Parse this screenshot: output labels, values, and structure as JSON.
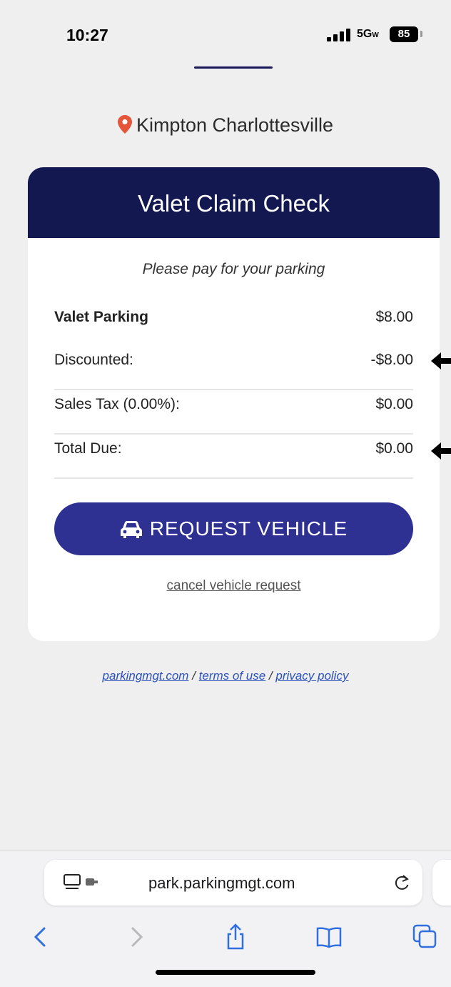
{
  "status_bar": {
    "time": "10:27",
    "network": "5G",
    "battery": "85"
  },
  "location": {
    "name": "Kimpton Charlottesville",
    "icon": "map-pin-icon",
    "icon_color": "#e4553a"
  },
  "card": {
    "title": "Valet Claim Check",
    "subtitle": "Please pay for your parking",
    "lines": [
      {
        "label": "Valet Parking",
        "value": "$8.00"
      },
      {
        "label": "Discounted:",
        "value": "-$8.00"
      },
      {
        "label": "Sales Tax (0.00%):",
        "value": "$0.00"
      },
      {
        "label": "Total Due:",
        "value": "$0.00"
      }
    ],
    "request_button": {
      "label": "REQUEST VEHICLE",
      "icon": "car-icon"
    },
    "cancel_link": "cancel vehicle request"
  },
  "footer": {
    "link_site": "parkingmgt.com",
    "link_terms": "terms of use",
    "link_privacy": "privacy policy",
    "separator": "/"
  },
  "browser": {
    "url": "park.parkingmgt.com",
    "toolbar": [
      "back-icon",
      "forward-icon",
      "share-icon",
      "bookmarks-icon",
      "tabs-icon"
    ]
  },
  "colors": {
    "header": "#141850",
    "button": "#2e3192",
    "link": "#2b52b8",
    "background": "#efeff0"
  }
}
